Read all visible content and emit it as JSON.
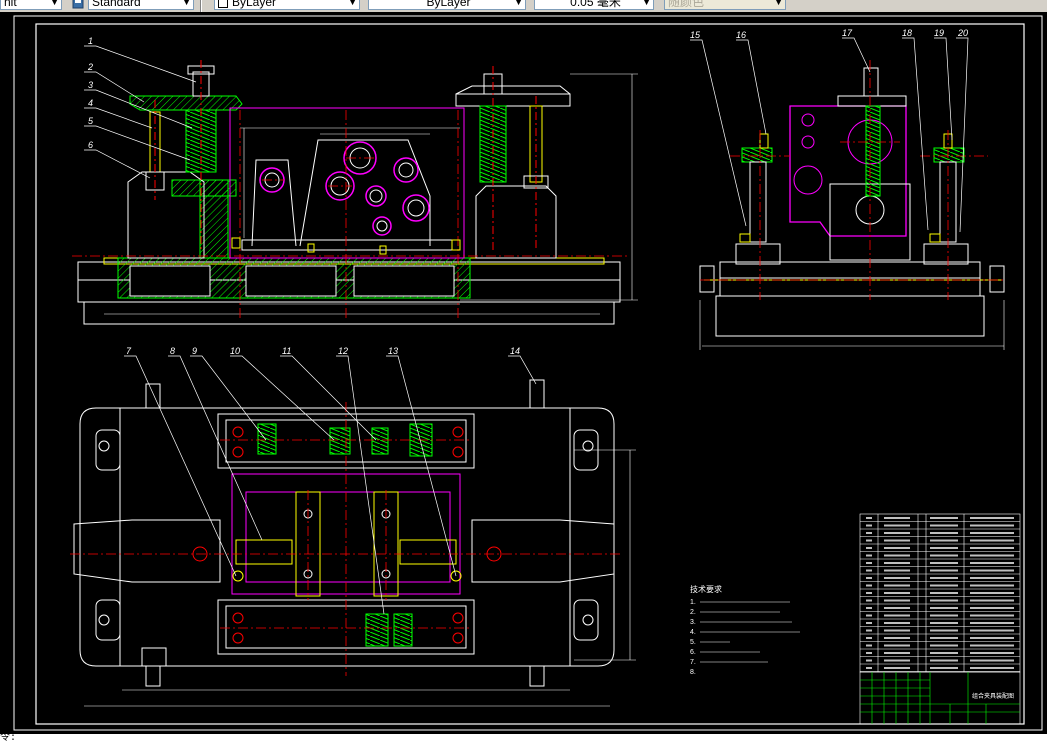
{
  "toolbar": {
    "textstyle_value": "nit",
    "dimstyle_value": "Standard",
    "layer_value": "ByLayer",
    "linetype_value": "ByLayer",
    "lineweight_value": "0.05 毫米",
    "plotstyle_value": "随颜色"
  },
  "drawing": {
    "part_labels": [
      "1",
      "2",
      "3",
      "4",
      "5",
      "6",
      "7",
      "8",
      "9",
      "10",
      "11",
      "12",
      "13",
      "14",
      "15",
      "16",
      "17",
      "18",
      "19",
      "20"
    ],
    "tech_notes_title": "技术要求",
    "tech_notes": [
      "1.",
      "2.",
      "3.",
      "4.",
      "5.",
      "6.",
      "7.",
      "8."
    ],
    "title_block_name": "组合夹具装配图"
  },
  "command_line": {
    "prompt": "令: "
  },
  "colors": {
    "background": "#000000",
    "white_lines": "#ffffff",
    "green": "#00ff00",
    "magenta": "#ff00ff",
    "red_center": "#ff0000",
    "yellow": "#ffff00",
    "cyan": "#00ffff"
  }
}
